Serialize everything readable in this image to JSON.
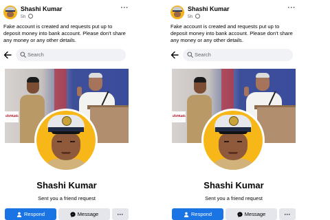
{
  "post": {
    "author": "Shashi Kumar",
    "time": "5h",
    "text": "Fake account is created and requests put up to deposit money into bank account. Please don't share any money or any other details.",
    "more_icon": "more-dots-icon"
  },
  "search": {
    "placeholder": "Search"
  },
  "cover": {
    "board_text": "ಬೆಂಗಳೂರು"
  },
  "profile": {
    "name": "Shashi Kumar",
    "request_text": "Sent you a friend request"
  },
  "actions": {
    "respond_label": "Respond",
    "message_label": "Message",
    "more_label": "···"
  },
  "colors": {
    "primary_blue": "#1b74e4",
    "secondary_gray": "#e4e6eb",
    "avatar_yellow": "#f8b719"
  }
}
